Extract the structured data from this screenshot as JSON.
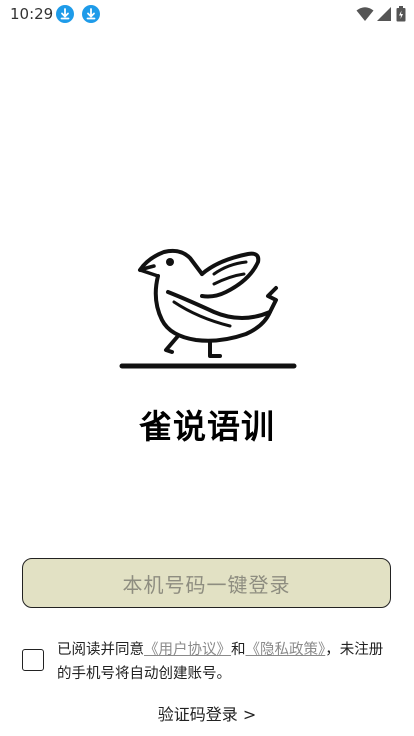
{
  "status_bar": {
    "time": "10:29",
    "icons": [
      "download-icon",
      "download-icon",
      "wifi-icon",
      "signal-icon",
      "battery-icon"
    ],
    "accent_color": "#1e9be9"
  },
  "app": {
    "logo_icon": "sparrow-logo-icon",
    "name": "雀说语训"
  },
  "login": {
    "one_click_label": "本机号码一键登录",
    "button_bg": "#e2e1c4"
  },
  "agreement": {
    "checked": false,
    "prefix": "已阅读并同意",
    "user_agreement": "《用户协议》",
    "and": "和",
    "privacy_policy": "《隐私政策》",
    "suffix": "，未注册的手机号将自动创建账号。"
  },
  "sms_login_label": "验证码登录 >"
}
